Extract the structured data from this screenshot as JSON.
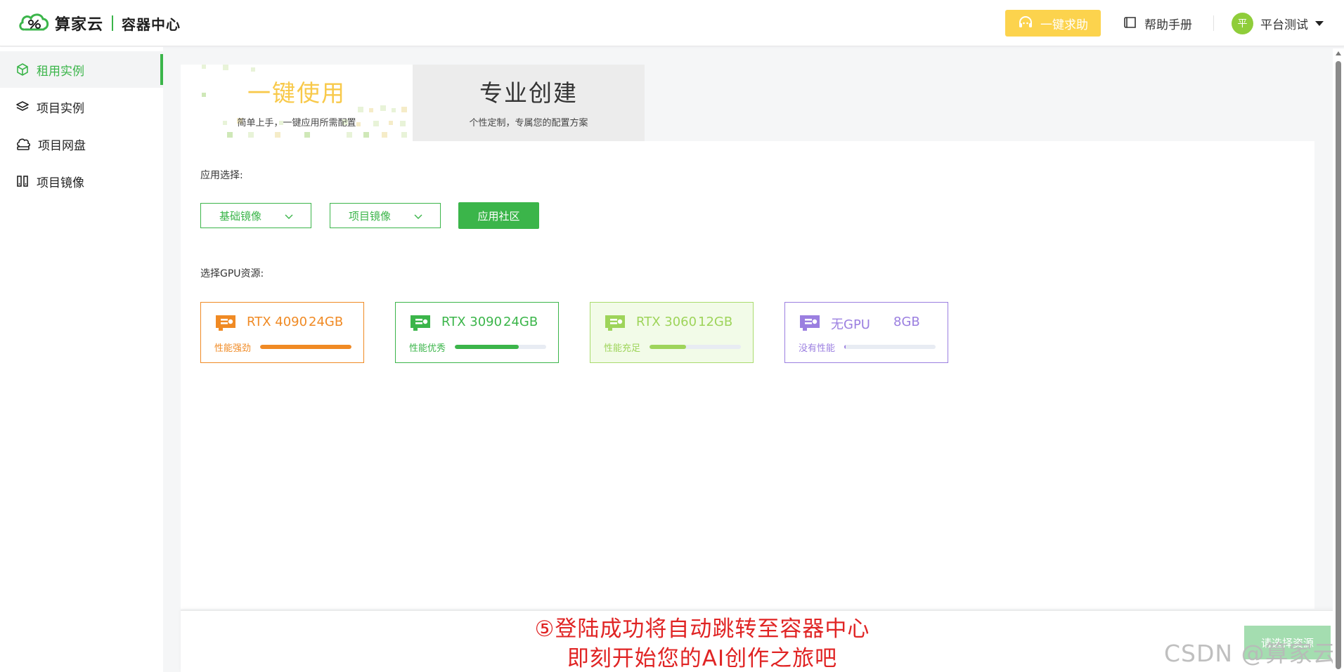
{
  "header": {
    "brand_name": "算家云",
    "brand_sub": "容器中心",
    "help_button": "一键求助",
    "manual_link": "帮助手册",
    "user_avatar": "平",
    "user_name": "平台测试"
  },
  "sidebar": {
    "items": [
      {
        "label": "租用实例",
        "icon": "cube-icon",
        "active": true
      },
      {
        "label": "项目实例",
        "icon": "layers-icon",
        "active": false
      },
      {
        "label": "项目网盘",
        "icon": "cloud-drive-icon",
        "active": false
      },
      {
        "label": "项目镜像",
        "icon": "image-mirror-icon",
        "active": false
      }
    ]
  },
  "tabs": {
    "quick": {
      "title": "一键使用",
      "desc": "简单上手，一键应用所需配置"
    },
    "pro": {
      "title": "专业创建",
      "desc": "个性定制，专属您的配置方案"
    }
  },
  "app_select": {
    "label": "应用选择:",
    "base_image": "基础镜像",
    "project_image": "项目镜像",
    "community": "应用社区"
  },
  "gpu": {
    "label": "选择GPU资源:",
    "cards": [
      {
        "name": "RTX 4090",
        "mem": "24GB",
        "perf": "性能强劲",
        "level": 1.0,
        "color": "#f08a24",
        "border": "#f08a24",
        "bg": "#ffffff"
      },
      {
        "name": "RTX 3090",
        "mem": "24GB",
        "perf": "性能优秀",
        "level": 0.7,
        "color": "#3bb54a",
        "border": "#3bb54a",
        "bg": "#ffffff"
      },
      {
        "name": "RTX 3060",
        "mem": "12GB",
        "perf": "性能充足",
        "level": 0.4,
        "color": "#9ed45a",
        "border": "#a9db6d",
        "bg": "#f2fbe8"
      },
      {
        "name": "无GPU",
        "mem": "8GB",
        "perf": "没有性能",
        "level": 0.01,
        "color": "#9b7fe0",
        "border": "#9b7fe0",
        "bg": "#ffffff"
      }
    ]
  },
  "bottom": {
    "caption_line1": "⑤登陆成功将自动跳转至容器中心",
    "caption_line2": "即刻开始您的AI创作之旅吧",
    "next_button": "请选择资源",
    "watermark": "CSDN @算家云"
  }
}
